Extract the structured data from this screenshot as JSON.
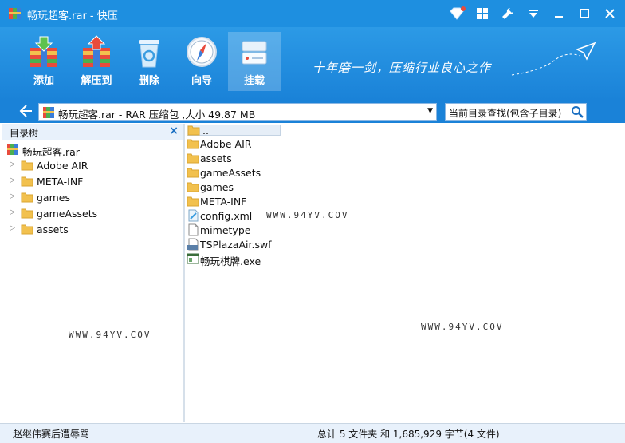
{
  "window": {
    "title": "畅玩超客.rar - 快压"
  },
  "toolbar": {
    "tools": [
      {
        "label": "添加",
        "icon": "add-archive-icon"
      },
      {
        "label": "解压到",
        "icon": "extract-archive-icon"
      },
      {
        "label": "删除",
        "icon": "recycle-bin-icon"
      },
      {
        "label": "向导",
        "icon": "compass-icon"
      },
      {
        "label": "挂载",
        "icon": "drive-mount-icon"
      }
    ],
    "slogan": "十年磨一剑，压缩行业良心之作"
  },
  "address": {
    "path": "畅玩超客.rar - RAR 压缩包 ,大小 49.87 MB",
    "search_placeholder": "当前目录查找(包含子目录)"
  },
  "tree": {
    "header": "目录树",
    "root": "畅玩超客.rar",
    "items": [
      "Adobe AIR",
      "META-INF",
      "games",
      "gameAssets",
      "assets"
    ]
  },
  "files": {
    "up": "..",
    "items": [
      {
        "name": "Adobe AIR",
        "type": "folder"
      },
      {
        "name": "assets",
        "type": "folder"
      },
      {
        "name": "gameAssets",
        "type": "folder"
      },
      {
        "name": "games",
        "type": "folder"
      },
      {
        "name": "META-INF",
        "type": "folder"
      },
      {
        "name": "config.xml",
        "type": "xml"
      },
      {
        "name": "mimetype",
        "type": "file"
      },
      {
        "name": "TSPlazaAir.swf",
        "type": "swf"
      },
      {
        "name": "畅玩棋牌.exe",
        "type": "exe"
      }
    ]
  },
  "watermarks": [
    "WWW.94YV.COV",
    "WWW.94YV.COV",
    "WWW.94YV.COV"
  ],
  "status": {
    "left": "赵继伟赛后遭辱骂",
    "right": "总计 5 文件夹  和  1,685,929 字节(4 文件)"
  },
  "colors": {
    "accent": "#1e8fe0",
    "folder": "#f2c14e"
  }
}
